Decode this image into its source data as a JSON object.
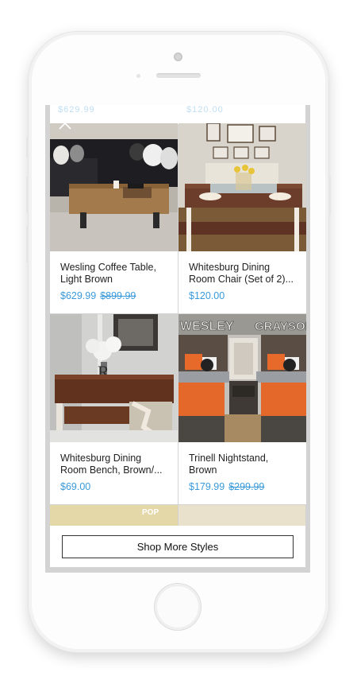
{
  "ghost_prices": [
    "$629.99",
    "$120.00"
  ],
  "products": [
    {
      "title": "Wesling Coffee Table, Light Brown",
      "price": "$629.99",
      "was_price": "$899.99",
      "image_icon": "coffee-table-photo"
    },
    {
      "title": "Whitesburg Dining Room Chair (Set of 2)...",
      "price": "$120.00",
      "was_price": "",
      "image_icon": "dining-chair-photo"
    },
    {
      "title": "Whitesburg Dining Room Bench, Brown/...",
      "price": "$69.00",
      "was_price": "",
      "image_icon": "dining-bench-photo"
    },
    {
      "title": "Trinell Nightstand, Brown",
      "price": "$179.99",
      "was_price": "$299.99",
      "image_icon": "nightstand-photo"
    }
  ],
  "photo_signs": {
    "wall_1": "WESLEY",
    "wall_2": "GRAYSON",
    "poster": "POP"
  },
  "footer": {
    "shop_more_label": "Shop More Styles"
  },
  "colors": {
    "price": "#3a9ad9",
    "screen_bg": "#d3d3d3"
  }
}
